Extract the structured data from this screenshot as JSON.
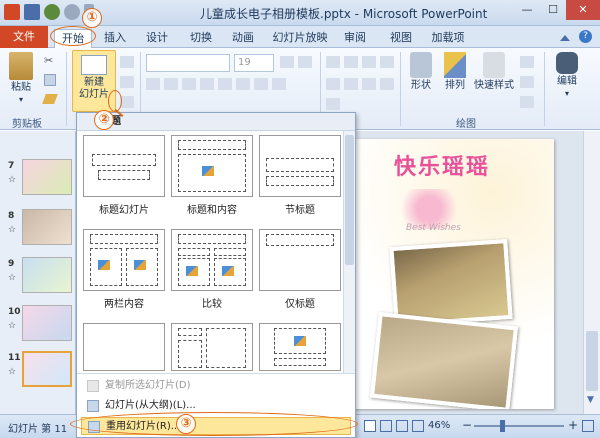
{
  "window": {
    "title": "儿童成长电子相册模板.pptx - Microsoft PowerPoint",
    "min": "—",
    "max": "☐",
    "close": "✕"
  },
  "tabs": [
    "文件",
    "开始",
    "插入",
    "设计",
    "切换",
    "动画",
    "幻灯片放映",
    "审阅",
    "视图",
    "加载项"
  ],
  "ribbon": {
    "paste_label": "粘贴",
    "clipboard_group": "剪贴板",
    "new_slide_label_1": "新建",
    "new_slide_label_2": "幻灯片",
    "font_size_value": "19",
    "shapes_label": "形状",
    "arrange_label": "排列",
    "quick_styles_label": "快速样式",
    "drawing_group": "绘图",
    "edit_label": "编辑"
  },
  "dropdown": {
    "header": "主题",
    "layouts": [
      "标题幻灯片",
      "标题和内容",
      "节标题",
      "两栏内容",
      "比较",
      "仅标题",
      "",
      "",
      ""
    ],
    "menu": [
      "复制所选幻灯片(D)",
      "幻灯片(从大纲)(L)...",
      "重用幻灯片(R)..."
    ]
  },
  "thumbnails": [
    {
      "num": "7",
      "star": "☆"
    },
    {
      "num": "8",
      "star": "☆"
    },
    {
      "num": "9",
      "star": "☆"
    },
    {
      "num": "10",
      "star": "☆"
    },
    {
      "num": "11",
      "star": "☆"
    }
  ],
  "slide": {
    "headline": "快乐瑶瑶",
    "subtitle": "Best Wishes"
  },
  "status": {
    "slide_info": "幻灯片 第 11",
    "zoom": "46%",
    "zoom_minus": "−",
    "zoom_plus": "+"
  },
  "callouts": [
    "①",
    "②",
    "③"
  ],
  "colors": {
    "accent": "#e06a16",
    "file_tab": "#d24726"
  }
}
